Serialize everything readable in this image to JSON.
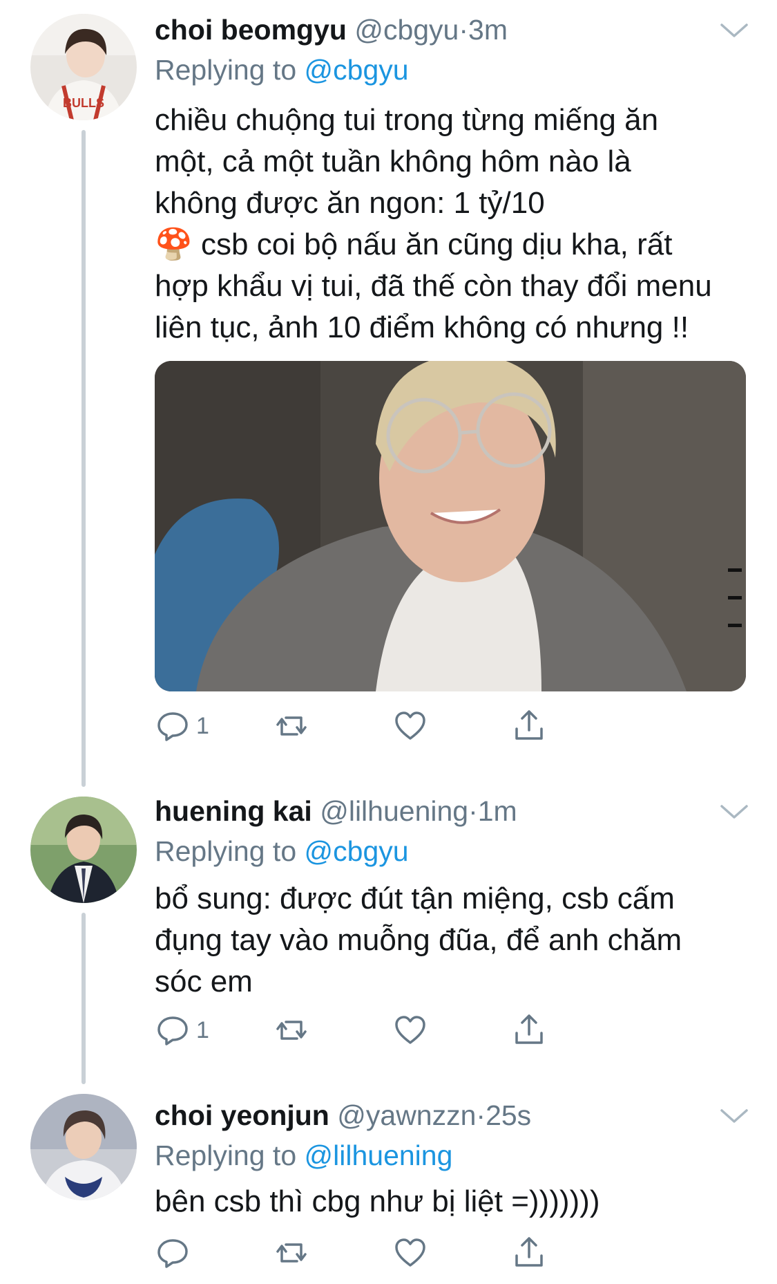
{
  "tweets": [
    {
      "name": "choi beomgyu",
      "handle": "@cbgyu",
      "dot": "·",
      "time": "3m",
      "replying_prefix": "Replying to ",
      "replying_to": "@cbgyu",
      "text": "chiều chuộng tui trong từng miếng ăn\nmột, cả một tuần không hôm nào là\nkhông được ăn ngon: 1 tỷ/10\n🍄 csb coi bộ nấu ăn cũng dịu kha, rất\nhợp khẩu vị tui, đã thế còn thay đổi menu\nliên tục, ảnh 10 điểm không có nhưng !!",
      "reply_count": "1"
    },
    {
      "name": "huening kai",
      "handle": "@lilhuening",
      "dot": "·",
      "time": "1m",
      "replying_prefix": "Replying to ",
      "replying_to": "@cbgyu",
      "text": "bổ sung: được đút tận miệng, csb cấm\nđụng tay vào muỗng đũa, để anh chăm\nsóc em",
      "reply_count": "1"
    },
    {
      "name": "choi yeonjun",
      "handle": "@yawnzzn",
      "dot": "·",
      "time": "25s",
      "replying_prefix": "Replying to ",
      "replying_to": "@lilhuening",
      "text": "bên csb thì cbg như bị liệt =)))))))",
      "reply_count": ""
    }
  ],
  "colors": {
    "text": "#14171a",
    "secondary": "#657786",
    "link": "#1b95e0",
    "thread_line": "#c9d0d6"
  },
  "icons": [
    "reply-icon",
    "retweet-icon",
    "like-icon",
    "share-icon",
    "chevron-down-icon"
  ]
}
